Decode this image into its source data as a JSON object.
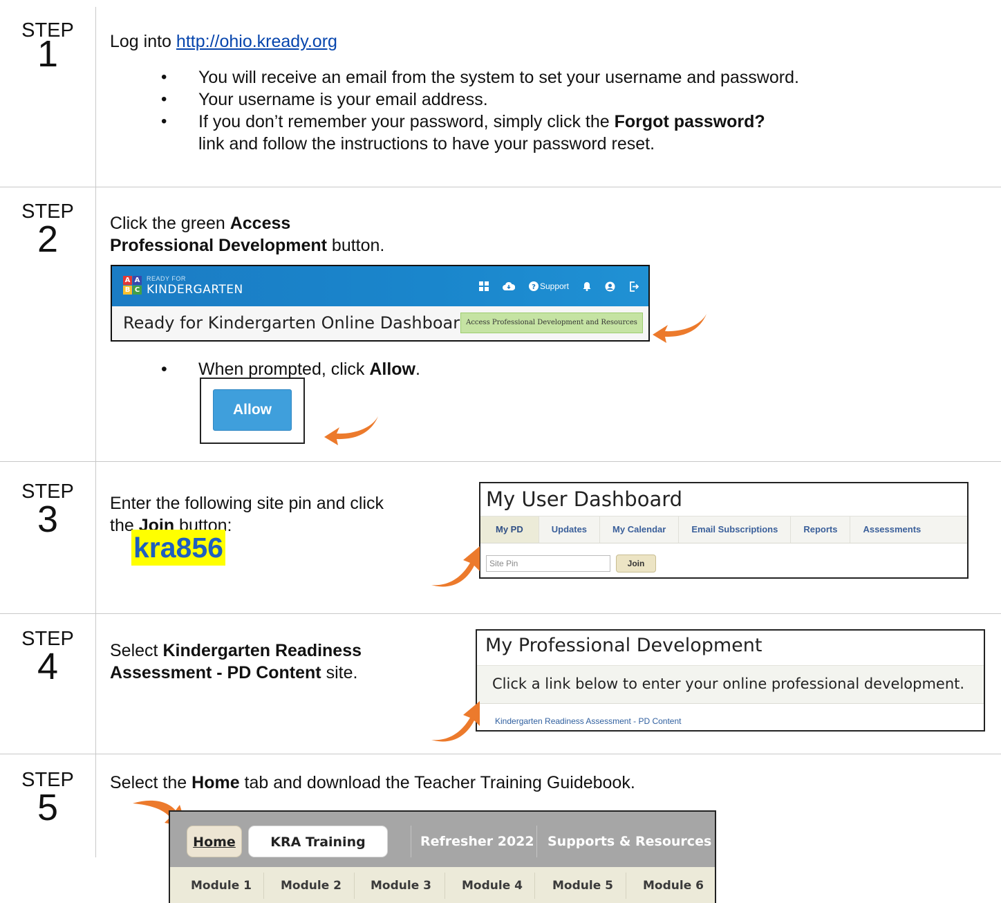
{
  "steps": [
    {
      "label": "STEP",
      "number": "1"
    },
    {
      "label": "STEP",
      "number": "2"
    },
    {
      "label": "STEP",
      "number": "3"
    },
    {
      "label": "STEP",
      "number": "4"
    },
    {
      "label": "STEP",
      "number": "5"
    }
  ],
  "step1": {
    "prefix": "Log into ",
    "link": "http://ohio.kready.org",
    "bullets": [
      "You will receive an email from the system to set your username and password.",
      "Your username is your email address."
    ],
    "bullet3_a": "If you don’t remember your password, simply click the ",
    "bullet3_bold": "Forgot password?",
    "bullet3_b": "link and follow the instructions to have your password reset."
  },
  "step2": {
    "line1_a": "Click the green ",
    "line1_bold": "Access",
    "line2_bold": "Professional Development",
    "line2_b": " button.",
    "banner": {
      "logo_letters": [
        "A",
        "A",
        "B",
        "C"
      ],
      "ready_for": "READY FOR",
      "kindergarten": "KINDERGARTEN",
      "support": "Support",
      "dashboard_title": "Ready for Kindergarten Online Dashboard",
      "green_button": "Access Professional Development and Resources"
    },
    "prompt_a": "When prompted, click ",
    "prompt_bold": "Allow",
    "prompt_b": ".",
    "allow_button": "Allow"
  },
  "step3": {
    "line1": "Enter the following site pin and click",
    "line2_a": "the ",
    "line2_bold": "Join",
    "line2_b": " button:",
    "pin": "kra856",
    "dashboard": {
      "title": "My User Dashboard",
      "tabs": [
        "My PD",
        "Updates",
        "My Calendar",
        "Email Subscriptions",
        "Reports",
        "Assessments"
      ],
      "site_pin_placeholder": "Site Pin",
      "join_button": "Join"
    }
  },
  "step4": {
    "line1_a": "Select ",
    "line1_bold": "Kindergarten Readiness",
    "line2_bold": "Assessment - PD Content",
    "line2_b": " site.",
    "panel": {
      "title": "My Professional Development",
      "instruction": "Click a link below to enter your online professional development.",
      "link": "Kindergarten Readiness Assessment - PD Content"
    }
  },
  "step5": {
    "line_a": "Select the ",
    "line_bold": "Home",
    "line_b": " tab and download the Teacher Training Guidebook.",
    "tabs": [
      "Home",
      "KRA Training Modules",
      "Refresher 2022",
      "Supports & Resources"
    ],
    "modules": [
      "Module 1",
      "Module 2",
      "Module 3",
      "Module 4",
      "Module 5",
      "Module 6"
    ]
  },
  "colors": {
    "arrow": "#ec7a2c",
    "link": "#0645ad",
    "pin_highlight": "#ffff00",
    "pin_text": "#1f5fbf",
    "banner_blue": "#1b7cc4",
    "green_button": "#c5e3a3",
    "allow_blue": "#3f9fdc"
  }
}
